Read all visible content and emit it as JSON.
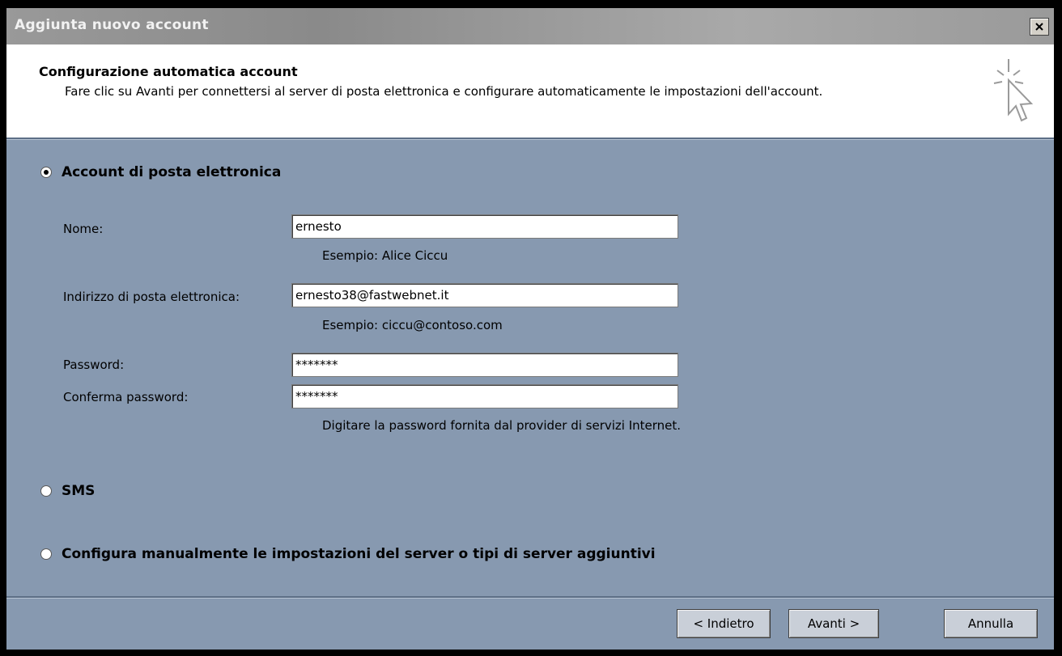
{
  "window": {
    "title": "Aggiunta nuovo account",
    "close_label": "×"
  },
  "header": {
    "title": "Configurazione automatica account",
    "description": "Fare clic su Avanti per connettersi al server di posta elettronica e configurare automaticamente le impostazioni dell'account."
  },
  "options": {
    "email": {
      "label": "Account di posta elettronica",
      "selected": true
    },
    "sms": {
      "label": "SMS",
      "selected": false
    },
    "manual": {
      "label": "Configura manualmente le impostazioni del server o tipi di server aggiuntivi",
      "selected": false
    }
  },
  "form": {
    "name": {
      "label": "Nome:",
      "value": "ernesto",
      "hint": "Esempio: Alice Ciccu"
    },
    "email": {
      "label": "Indirizzo di posta elettronica:",
      "value": "ernesto38@fastwebnet.it",
      "hint": "Esempio: ciccu@contoso.com"
    },
    "password": {
      "label": "Password:",
      "value": "*******"
    },
    "confirm_password": {
      "label": "Conferma password:",
      "value": "*******",
      "hint": "Digitare la password fornita dal provider di servizi Internet."
    }
  },
  "buttons": {
    "back": "< Indietro",
    "next": "Avanti >",
    "cancel": "Annulla"
  },
  "colors": {
    "dialog_background": "#8799b0",
    "header_background": "#ffffff",
    "titlebar": "#999999"
  },
  "icons": {
    "wizard": "cursor-click-icon",
    "close": "close-icon"
  }
}
